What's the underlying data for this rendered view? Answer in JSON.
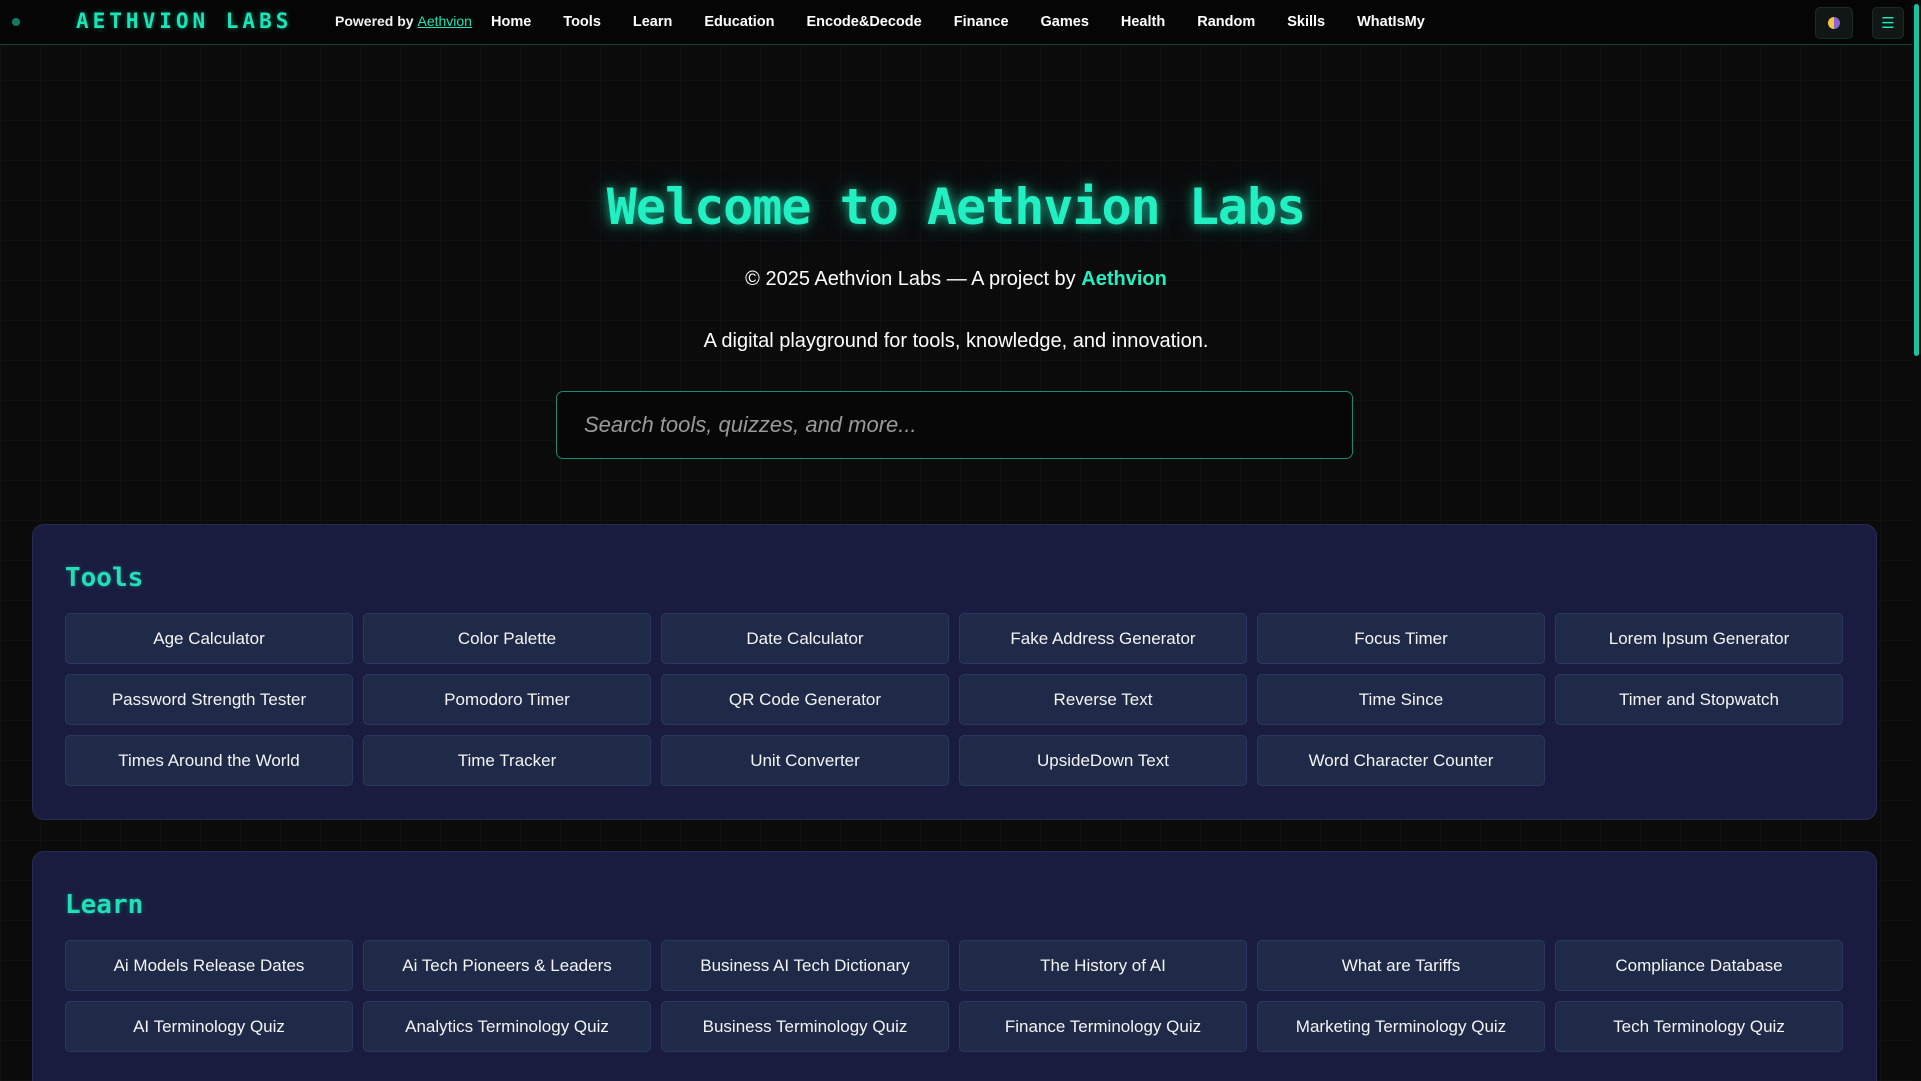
{
  "header": {
    "logo": "AETHVION LABS",
    "powered_prefix": "Powered by",
    "powered_link": "Aethvion",
    "nav": [
      "Home",
      "Tools",
      "Learn",
      "Education",
      "Encode&Decode",
      "Finance",
      "Games",
      "Health",
      "Random",
      "Skills",
      "WhatIsMy"
    ],
    "theme_icon": "theme-toggle-icon",
    "menu_icon": "hamburger-menu-icon"
  },
  "hero": {
    "title": "Welcome to Aethvion Labs",
    "copyright_prefix": "© 2025 Aethvion Labs — A project by",
    "copyright_brand": "Aethvion",
    "tagline": "A digital playground for tools, knowledge, and innovation."
  },
  "search": {
    "placeholder": "Search tools, quizzes, and more..."
  },
  "sections": {
    "tools": {
      "title": "Tools",
      "items": [
        "Age Calculator",
        "Color Palette",
        "Date Calculator",
        "Fake Address Generator",
        "Focus Timer",
        "Lorem Ipsum Generator",
        "Password Strength Tester",
        "Pomodoro Timer",
        "QR Code Generator",
        "Reverse Text",
        "Time Since",
        "Timer and Stopwatch",
        "Times Around the World",
        "Time Tracker",
        "Unit Converter",
        "UpsideDown Text",
        "Word Character Counter"
      ]
    },
    "learn": {
      "title": "Learn",
      "items": [
        "Ai Models Release Dates",
        "Ai Tech Pioneers & Leaders",
        "Business AI Tech Dictionary",
        "The History of AI",
        "What are Tariffs",
        "Compliance Database",
        "AI Terminology Quiz",
        "Analytics Terminology Quiz",
        "Business Terminology Quiz",
        "Finance Terminology Quiz",
        "Marketing Terminology Quiz",
        "Tech Terminology Quiz"
      ]
    }
  },
  "colors": {
    "accent": "#21f0c2",
    "section_bg": "#1a1c3f",
    "tile_bg": "#1e2a48",
    "page_bg": "#0b0b0c"
  }
}
